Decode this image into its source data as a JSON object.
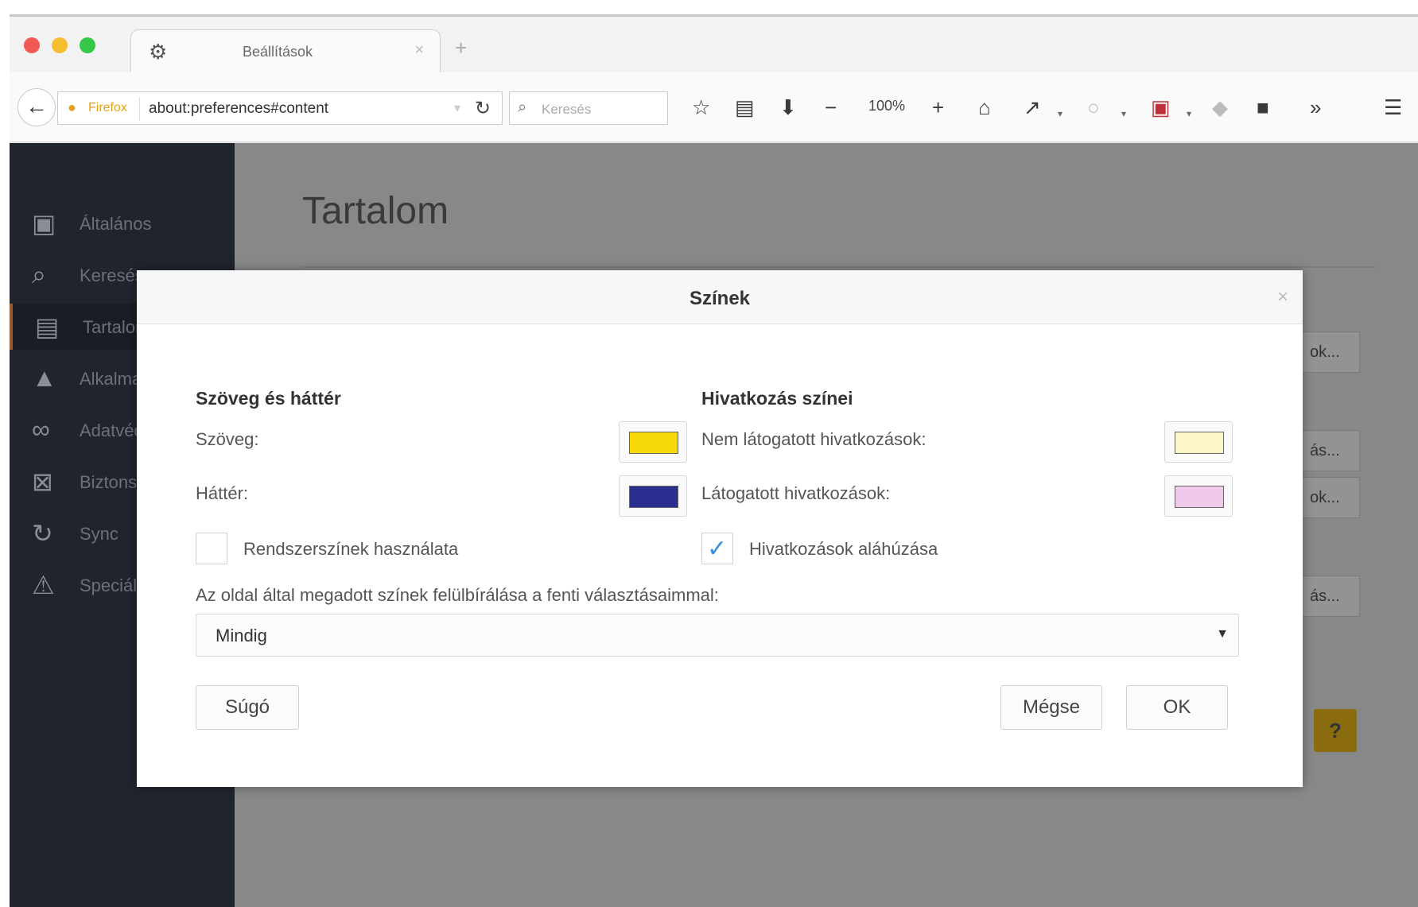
{
  "browser": {
    "tab": {
      "title": "Beállítások"
    },
    "url": {
      "identity_label": "Firefox",
      "text": "about:preferences#content"
    },
    "search": {
      "placeholder": "Keresés"
    },
    "zoom": "100%",
    "overflow": "»"
  },
  "sidebar": {
    "items": [
      {
        "label": "Általános",
        "icon": "general-icon"
      },
      {
        "label": "Keresés",
        "icon": "search-icon"
      },
      {
        "label": "Tartalom",
        "icon": "content-icon",
        "active": true
      },
      {
        "label": "Alkalmazások",
        "icon": "applications-icon"
      },
      {
        "label": "Adatvédelem",
        "icon": "privacy-icon"
      },
      {
        "label": "Biztonság",
        "icon": "security-icon"
      },
      {
        "label": "Sync",
        "icon": "sync-icon"
      },
      {
        "label": "Speciális",
        "icon": "advanced-icon"
      }
    ]
  },
  "page": {
    "title": "Tartalom",
    "peek_buttons": [
      "ok...",
      "ás...",
      "ok...",
      "ás..."
    ],
    "help_label": "?"
  },
  "dialog": {
    "title": "Színek",
    "close": "×",
    "text_bg_section": {
      "heading": "Szöveg és háttér",
      "text_label": "Szöveg:",
      "background_label": "Háttér:",
      "system_colors_label": "Rendszerszínek használata"
    },
    "link_section": {
      "heading": "Hivatkozás színei",
      "unvisited_label": "Nem látogatott hivatkozások:",
      "visited_label": "Látogatott hivatkozások:",
      "underline_label": "Hivatkozások aláhúzása"
    },
    "override_label": "Az oldal által megadott színek felülbírálása a fenti választásaimmal:",
    "override_value": "Mindig",
    "help_button": "Súgó",
    "cancel_button": "Mégse",
    "ok_button": "OK",
    "colors": {
      "text": "#f5d90a",
      "background": "#2a2f8f",
      "unvisited": "#fbf6c8",
      "visited": "#efc8ea"
    },
    "system_colors_checked": false,
    "underline_checked": true
  }
}
